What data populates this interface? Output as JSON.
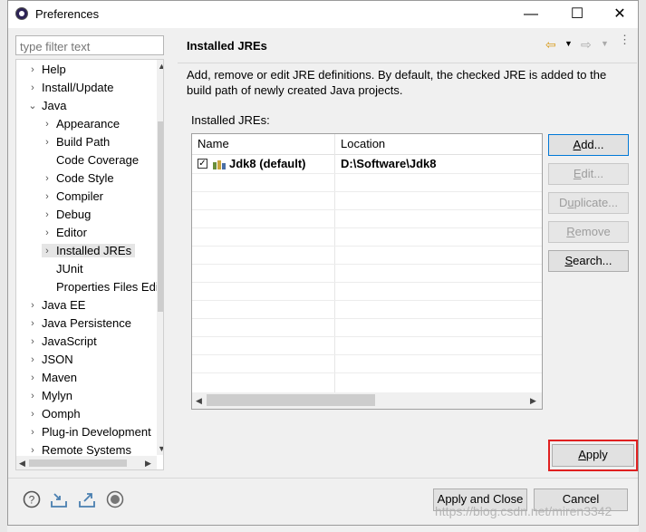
{
  "window": {
    "title": "Preferences",
    "minimize": "—",
    "maximize": "☐",
    "close": "✕"
  },
  "filter": {
    "placeholder": "type filter text"
  },
  "tree": [
    {
      "label": "Help",
      "indent": 0,
      "twisty": "›"
    },
    {
      "label": "Install/Update",
      "indent": 0,
      "twisty": "›"
    },
    {
      "label": "Java",
      "indent": 0,
      "twisty": "⌄"
    },
    {
      "label": "Appearance",
      "indent": 1,
      "twisty": "›"
    },
    {
      "label": "Build Path",
      "indent": 1,
      "twisty": "›"
    },
    {
      "label": "Code Coverage",
      "indent": 1,
      "twisty": ""
    },
    {
      "label": "Code Style",
      "indent": 1,
      "twisty": "›"
    },
    {
      "label": "Compiler",
      "indent": 1,
      "twisty": "›"
    },
    {
      "label": "Debug",
      "indent": 1,
      "twisty": "›"
    },
    {
      "label": "Editor",
      "indent": 1,
      "twisty": "›"
    },
    {
      "label": "Installed JREs",
      "indent": 1,
      "twisty": "›",
      "selected": true
    },
    {
      "label": "JUnit",
      "indent": 1,
      "twisty": ""
    },
    {
      "label": "Properties Files Edi",
      "indent": 1,
      "twisty": ""
    },
    {
      "label": "Java EE",
      "indent": 0,
      "twisty": "›"
    },
    {
      "label": "Java Persistence",
      "indent": 0,
      "twisty": "›"
    },
    {
      "label": "JavaScript",
      "indent": 0,
      "twisty": "›"
    },
    {
      "label": "JSON",
      "indent": 0,
      "twisty": "›"
    },
    {
      "label": "Maven",
      "indent": 0,
      "twisty": "›"
    },
    {
      "label": "Mylyn",
      "indent": 0,
      "twisty": "›"
    },
    {
      "label": "Oomph",
      "indent": 0,
      "twisty": "›"
    },
    {
      "label": "Plug-in Development",
      "indent": 0,
      "twisty": "›"
    },
    {
      "label": "Remote Systems",
      "indent": 0,
      "twisty": "›"
    }
  ],
  "page": {
    "title": "Installed JREs",
    "description": "Add, remove or edit JRE definitions. By default, the checked JRE is added to the build path of newly created Java projects.",
    "installed_label": "Installed JREs:",
    "columns": {
      "name": "Name",
      "location": "Location"
    },
    "rows": [
      {
        "name": "Jdk8 (default)",
        "location": "D:\\Software\\Jdk8",
        "checked": true
      }
    ]
  },
  "buttons": {
    "add": {
      "pre": "",
      "u": "A",
      "post": "dd..."
    },
    "edit": {
      "pre": "",
      "u": "E",
      "post": "dit..."
    },
    "duplicate": {
      "pre": "D",
      "u": "u",
      "post": "plicate..."
    },
    "remove": {
      "pre": "",
      "u": "R",
      "post": "emove"
    },
    "search": {
      "pre": "",
      "u": "S",
      "post": "earch..."
    },
    "apply": {
      "pre": "",
      "u": "A",
      "post": "pply"
    },
    "apply_close": "Apply and Close",
    "cancel": "Cancel"
  },
  "watermark": "https://blog.csdn.net/miren3342",
  "colors": {
    "highlight": "#e02020",
    "accent": "#0078d7"
  }
}
